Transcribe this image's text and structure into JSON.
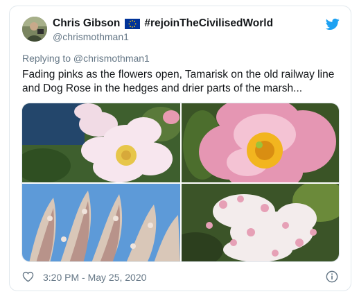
{
  "tweet": {
    "author_name": "Chris Gibson",
    "author_name_suffix": "#rejoinTheCivilisedWorld",
    "handle": "@chrismothman1",
    "reply_context": "Replying to @chrismothman1",
    "text": "Fading pinks as the flowers open, Tamarisk on the old railway line and Dog Rose in the hedges and drier parts of the marsh...",
    "timestamp": "3:20 PM - May 25, 2020"
  },
  "icons": {
    "brand": "twitter-bird-icon",
    "flag": "eu-flag-icon",
    "like": "heart-icon",
    "info": "info-icon"
  },
  "colors": {
    "brand": "#1da1f2",
    "secondary_text": "#657786",
    "border": "#e1e8ed"
  },
  "media": {
    "photos": [
      {
        "subject": "dog rose flower, pale pink"
      },
      {
        "subject": "dog rose flower close-up, pink"
      },
      {
        "subject": "tamarisk flower spikes"
      },
      {
        "subject": "tamarisk blossoms close-up"
      }
    ]
  }
}
